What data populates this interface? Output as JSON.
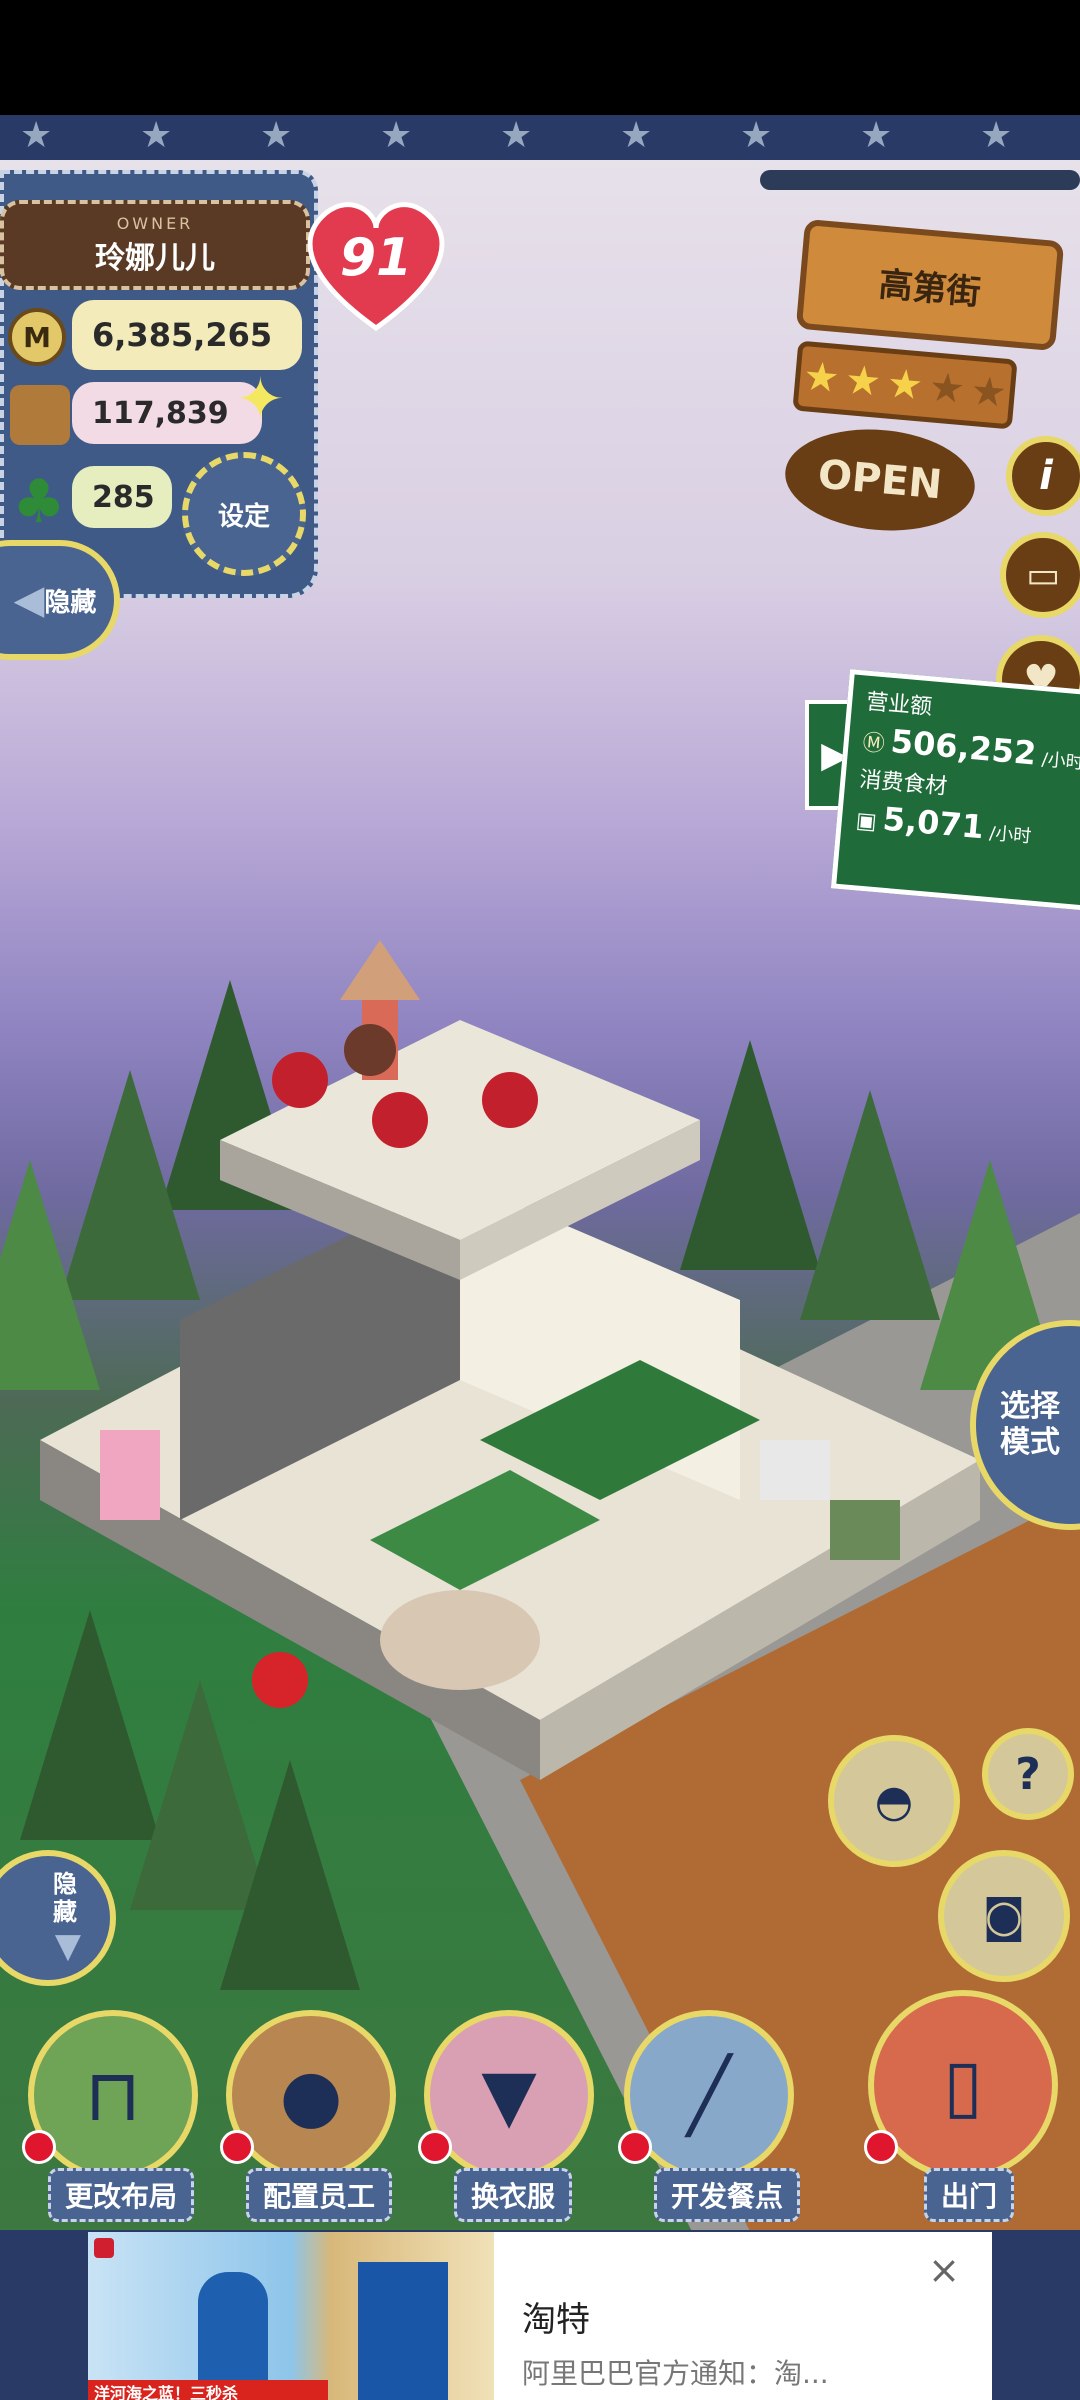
{
  "owner": {
    "badge": "OWNER",
    "name": "玲娜儿儿",
    "level": "91"
  },
  "stats": {
    "money": "6,385,265",
    "food": "117,839",
    "clover": "285"
  },
  "buttons": {
    "settings": "设定",
    "hide_top": "隐藏",
    "hide_bottom": "隐藏"
  },
  "street": {
    "name": "高第街",
    "stars_filled": 3,
    "stars_total": 5,
    "open_label": "OPEN"
  },
  "side_icons": [
    "info-icon",
    "book-icon",
    "heart-chat-icon"
  ],
  "revenue_board": {
    "title": "营业额",
    "revenue": "506,252",
    "revenue_unit": "/小时",
    "consume_title": "消费食材",
    "consume": "5,071",
    "consume_unit": "/小时"
  },
  "mode_button": "选择模式",
  "bottom_menu": [
    {
      "label": "更改布局",
      "icon": "table-icon",
      "color": "#6fa356"
    },
    {
      "label": "配置员工",
      "icon": "bear-icon",
      "color": "#b88650"
    },
    {
      "label": "换衣服",
      "icon": "shirt-icon",
      "color": "#d9a0b3"
    },
    {
      "label": "开发餐点",
      "icon": "knife-icon",
      "color": "#88a8c9"
    },
    {
      "label": "出门",
      "icon": "door-icon",
      "color": "#d76a4c"
    }
  ],
  "ad": {
    "title": "淘特",
    "subtitle": "阿里巴巴官方通知：淘...",
    "banner_text": "洋河海之蓝！三秒杀"
  },
  "colors": {
    "denim": "#3f5a86",
    "stitch": "#c9d3e6",
    "gold": "#e7d868",
    "board_green": "#1f6b3a",
    "sign_wood": "#cf8a3b",
    "heart": "#e23a4e"
  }
}
